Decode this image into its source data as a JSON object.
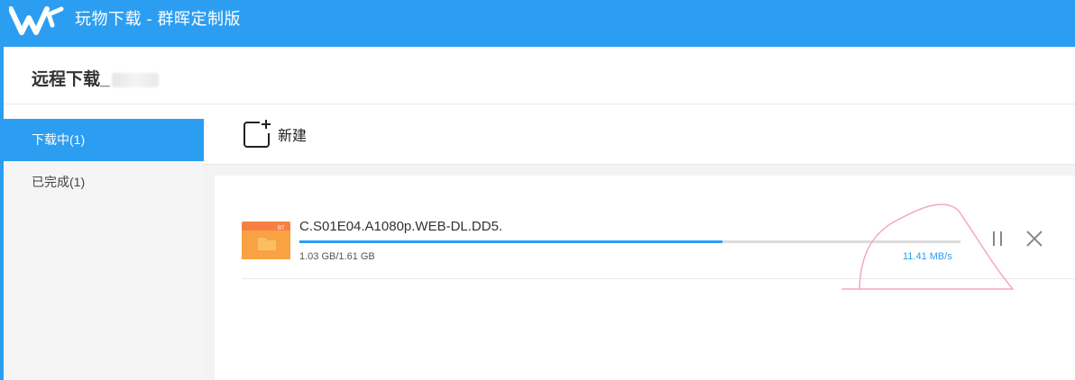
{
  "app": {
    "title": "玩物下载 - 群晖定制版",
    "brand_color": "#2c9ef2"
  },
  "page": {
    "title": "远程下载_"
  },
  "sidebar": {
    "items": [
      {
        "label": "下载中(1)",
        "active": true
      },
      {
        "label": "已完成(1)",
        "active": false
      }
    ]
  },
  "toolbar": {
    "new_label": "新建",
    "new_icon": "new-task-icon"
  },
  "downloads": [
    {
      "name": "C.S01E04.A1080p.WEB-DL.DD5.",
      "file_icon": "bt-folder-icon",
      "progress": 0.64,
      "size": "1.03 GB/1.61 GB",
      "speed": "11.41 MB/s",
      "pause_icon": "pause-icon",
      "close_icon": "close-icon"
    }
  ],
  "annotation_color": "#f3a6c8"
}
